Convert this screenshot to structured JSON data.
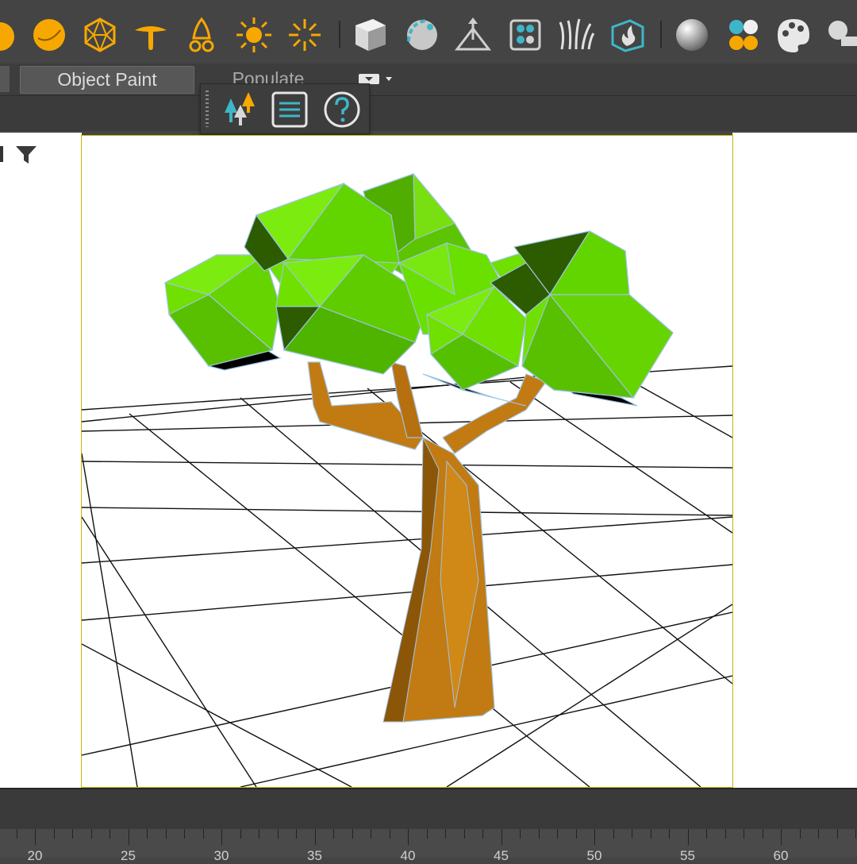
{
  "toolbar": {
    "icons": [
      "sphere-light-icon",
      "omni-light-icon",
      "geosphere-icon",
      "spot-light-icon",
      "photometric-light-icon",
      "sun-icon",
      "skylight-icon",
      "box-icon",
      "material-sphere-icon",
      "target-icon",
      "hair-icon",
      "grass-icon",
      "fire-effect-icon",
      "shader-ball-icon",
      "color-palette-icon",
      "paint-palette-icon",
      "render-icon"
    ],
    "accent": "#f5a623"
  },
  "tabs": {
    "object_paint": "Object Paint",
    "populate": "Populate"
  },
  "panel": {
    "icons": [
      "forest-icon",
      "list-icon",
      "help-icon"
    ]
  },
  "timeline": {
    "labels": [
      "20",
      "25",
      "30",
      "35",
      "40",
      "45",
      "50",
      "55",
      "60"
    ]
  },
  "colors": {
    "foliage": "#6fe000",
    "trunk": "#c27a12",
    "viewport_border": "#c9b400",
    "ui_bg": "#444444"
  }
}
